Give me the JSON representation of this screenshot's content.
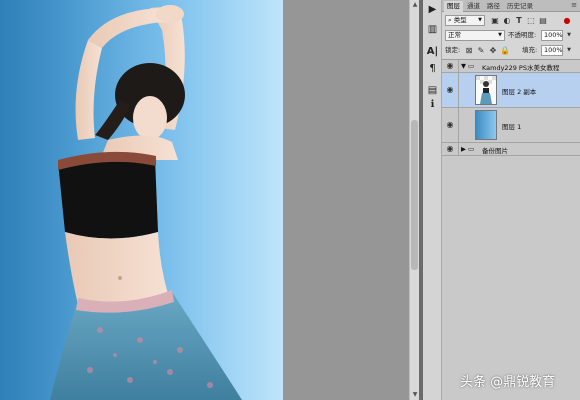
{
  "panel_tabs": [
    "图层",
    "通道",
    "路径",
    "历史记录"
  ],
  "panel_menu_icon": "menu-icon",
  "filter": {
    "kind_label": "类型",
    "icons": [
      "image-filter-icon",
      "adjustment-filter-icon",
      "type-filter-icon",
      "shape-filter-icon",
      "smart-object-filter-icon"
    ]
  },
  "blend": {
    "mode": "正常",
    "opacity_label": "不透明度:",
    "opacity_value": "100%"
  },
  "lock": {
    "label": "锁定:",
    "fill_label": "填充:",
    "fill_value": "100%",
    "icons": [
      "lock-transparent-icon",
      "lock-paint-icon",
      "lock-move-icon",
      "lock-all-icon"
    ]
  },
  "layers": [
    {
      "name": "Kamdy229  PS水美女教程",
      "type": "group",
      "expanded": true,
      "visible": true
    },
    {
      "name": "图层 2 副本",
      "type": "image",
      "selected": true,
      "visible": true
    },
    {
      "name": "图层 1",
      "type": "fill",
      "color": "#6ab3e6",
      "visible": true
    },
    {
      "name": "备份图片",
      "type": "group",
      "expanded": false,
      "visible": true
    }
  ],
  "tools": [
    "play-icon",
    "histogram-icon",
    "character-icon",
    "paragraph-icon",
    "info-icon"
  ],
  "colors": {
    "canvas_blue": "#7cc0ec",
    "selection": "#b7d0ef",
    "panel_bg": "#d6d6d6"
  },
  "watermark": "头条 @鼎锐教育"
}
